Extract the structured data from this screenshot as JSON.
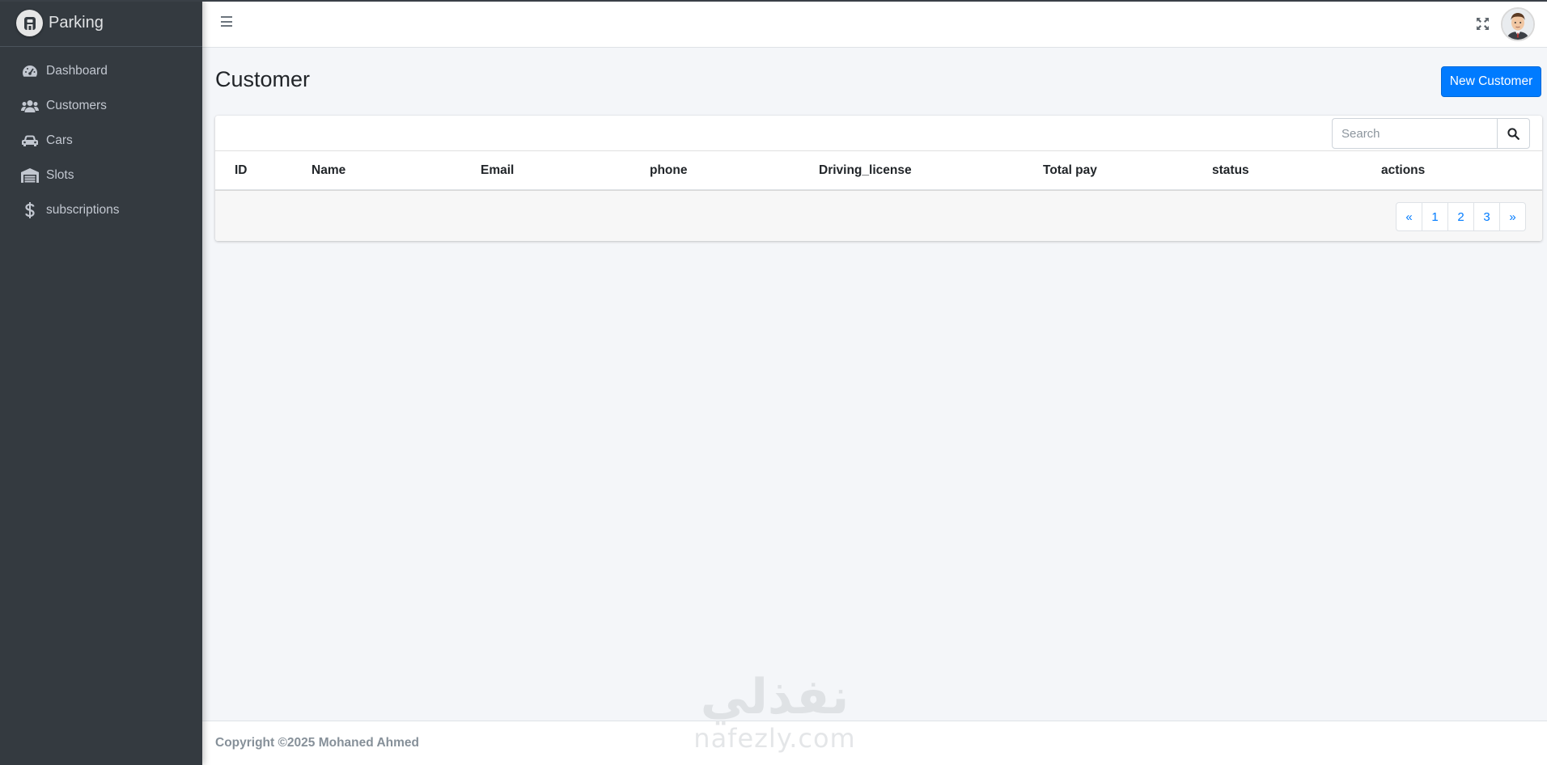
{
  "app": {
    "brand": "Parking"
  },
  "sidebar": {
    "items": [
      {
        "label": "Dashboard",
        "icon": "tachometer-icon"
      },
      {
        "label": "Customers",
        "icon": "users-icon"
      },
      {
        "label": "Cars",
        "icon": "car-icon"
      },
      {
        "label": "Slots",
        "icon": "warehouse-icon"
      },
      {
        "label": "subscriptions",
        "icon": "dollar-icon"
      }
    ]
  },
  "page": {
    "title": "Customer",
    "new_button": "New Customer"
  },
  "search": {
    "placeholder": "Search"
  },
  "table": {
    "columns": [
      "ID",
      "Name",
      "Email",
      "phone",
      "Driving_license",
      "Total pay",
      "status",
      "actions"
    ]
  },
  "pagination": {
    "prev": "«",
    "pages": [
      "1",
      "2",
      "3"
    ],
    "next": "»"
  },
  "footer": {
    "copyright": "Copyright ©2025 Mohaned Ahmed"
  },
  "watermark": {
    "arabic": "نفذلي",
    "latin": "nafezly.com"
  },
  "colors": {
    "sidebar_bg": "#343a40",
    "primary": "#007bff",
    "content_bg": "#f4f6f9"
  }
}
